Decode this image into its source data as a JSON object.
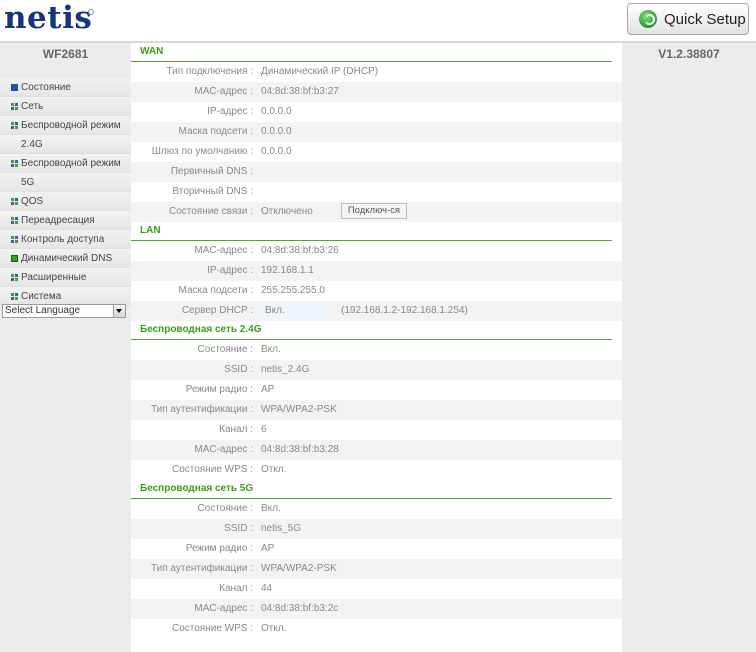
{
  "header": {
    "logo": "netis",
    "quick_setup": "Quick Setup"
  },
  "sidebar": {
    "model": "WF2681",
    "items": [
      {
        "label": "Состояние",
        "icon": "blue"
      },
      {
        "label": "Сеть",
        "icon": "grid"
      },
      {
        "label": "Беспроводной режим",
        "icon": "grid"
      },
      {
        "label": "2.4G",
        "icon": "none"
      },
      {
        "label": "Беспроводной режим",
        "icon": "grid"
      },
      {
        "label": "5G",
        "icon": "none"
      },
      {
        "label": "QOS",
        "icon": "grid"
      },
      {
        "label": "Переадресация",
        "icon": "grid"
      },
      {
        "label": "Контроль доступа",
        "icon": "grid"
      },
      {
        "label": "Динамический DNS",
        "icon": "green"
      },
      {
        "label": "Расширенные",
        "icon": "grid"
      },
      {
        "label": "Система",
        "icon": "grid"
      }
    ],
    "language": "Select Language"
  },
  "version": "V1.2.38807",
  "sections": {
    "wan": {
      "title": "WAN",
      "rows": [
        {
          "label": "Тип подключения :",
          "value": "Динамический IP (DHCP)"
        },
        {
          "label": "MAC-адрес :",
          "value": "04:8d:38:bf:b3:27"
        },
        {
          "label": "IP-адрес :",
          "value": "0.0.0.0"
        },
        {
          "label": "Маска подсети :",
          "value": "0.0.0.0"
        },
        {
          "label": "Шлюз по умолчанию :",
          "value": "0.0.0.0"
        },
        {
          "label": "Первичный DNS :",
          "value": ""
        },
        {
          "label": "Вторичный DNS :",
          "value": ""
        }
      ],
      "conn_label": "Состояние связи :",
      "conn_value": "Отключено",
      "conn_button": "Подключ-ся"
    },
    "lan": {
      "title": "LAN",
      "rows": [
        {
          "label": "MAC-адрес :",
          "value": "04:8d:38:bf:b3:26"
        },
        {
          "label": "IP-адрес :",
          "value": "192.168.1.1"
        },
        {
          "label": "Маска подсети :",
          "value": "255.255.255.0"
        }
      ],
      "dhcp_label": "Сервер DHCP :",
      "dhcp_value": "Вкл.",
      "dhcp_range": "(192.168.1.2-192.168.1.254)"
    },
    "wl24": {
      "title": "Беспроводная сеть 2.4G",
      "rows": [
        {
          "label": "Состояние :",
          "value": "Вкл."
        },
        {
          "label": "SSID :",
          "value": "netis_2.4G"
        },
        {
          "label": "Режим радио :",
          "value": "AP"
        },
        {
          "label": "Тип аутентификации :",
          "value": "WPA/WPA2-PSK"
        },
        {
          "label": "Канал :",
          "value": "6"
        },
        {
          "label": "MAC-адрес :",
          "value": "04:8d:38:bf:b3:28"
        },
        {
          "label": "Состояние WPS :",
          "value": "Откл."
        }
      ]
    },
    "wl5": {
      "title": "Беспроводная сеть 5G",
      "rows": [
        {
          "label": "Состояние :",
          "value": "Вкл."
        },
        {
          "label": "SSID :",
          "value": "netis_5G"
        },
        {
          "label": "Режим радио :",
          "value": "AP"
        },
        {
          "label": "Тип аутентификации :",
          "value": "WPA/WPA2-PSK"
        },
        {
          "label": "Канал :",
          "value": "44"
        },
        {
          "label": "MAC-адрес :",
          "value": "04:8d:38:bf:b3:2c"
        },
        {
          "label": "Состояние WPS :",
          "value": "Откл."
        }
      ]
    }
  }
}
